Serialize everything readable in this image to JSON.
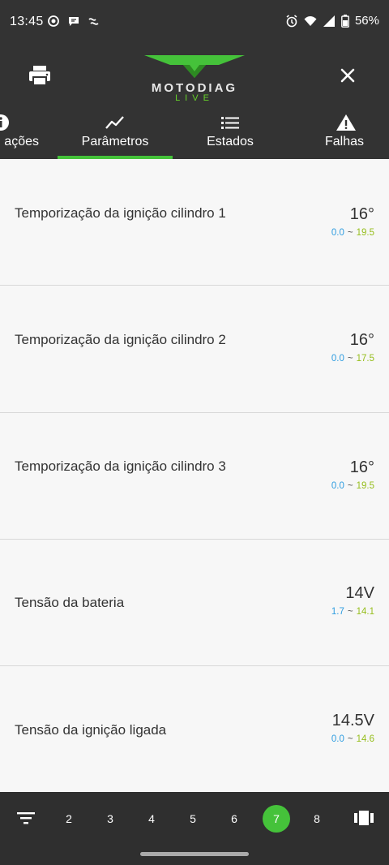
{
  "status_bar": {
    "time": "13:45",
    "battery": "56%",
    "icons": [
      "record-icon",
      "chat-bubble-icon",
      "wavy-arrow-icon",
      "alarm-icon",
      "wifi-icon",
      "signal-icon",
      "battery-icon"
    ]
  },
  "header": {
    "logo_word": "MOTODIAG",
    "logo_sub": "LIVE",
    "accent_color": "#45c23a"
  },
  "tabs": [
    {
      "label": "ações",
      "icon": "info-icon",
      "active": false
    },
    {
      "label": "Parâmetros",
      "icon": "trend-line-icon",
      "active": true
    },
    {
      "label": "Estados",
      "icon": "list-icon",
      "active": false
    },
    {
      "label": "Falhas",
      "icon": "warning-icon",
      "active": false
    }
  ],
  "parameters": [
    {
      "name": "Temporização da ignição cilindro 1",
      "value": "16°",
      "min": "0.0",
      "separator": "~",
      "max": "19.5"
    },
    {
      "name": "Temporização da ignição cilindro 2",
      "value": "16°",
      "min": "0.0",
      "separator": "~",
      "max": "17.5"
    },
    {
      "name": "Temporização da ignição cilindro 3",
      "value": "16°",
      "min": "0.0",
      "separator": "~",
      "max": "19.5"
    },
    {
      "name": "Tensão da bateria",
      "value": "14V",
      "min": "1.7",
      "separator": "~",
      "max": "14.1"
    },
    {
      "name": "Tensão da ignição ligada",
      "value": "14.5V",
      "min": "0.0",
      "separator": "~",
      "max": "14.6"
    }
  ],
  "pagination": {
    "pages": [
      "2",
      "3",
      "4",
      "5",
      "6",
      "7",
      "8"
    ],
    "current": "7"
  },
  "colors": {
    "min_value": "#2f9de0",
    "max_value": "#96be1c"
  }
}
